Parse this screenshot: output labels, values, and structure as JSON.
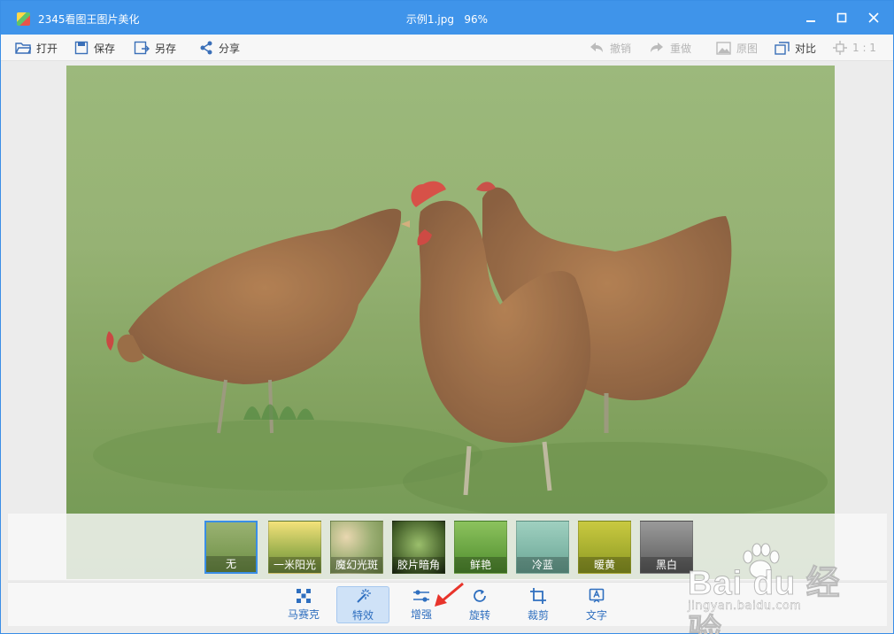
{
  "window": {
    "app_title": "2345看图王图片美化",
    "file_name": "示例1.jpg",
    "zoom": "96%"
  },
  "toolbar": {
    "open": "打开",
    "save": "保存",
    "save_as": "另存",
    "share": "分享",
    "undo": "撤销",
    "redo": "重做",
    "original": "原图",
    "compare": "对比",
    "ratio": "1 : 1"
  },
  "filters": [
    {
      "label": "无",
      "selected": true
    },
    {
      "label": "一米阳光",
      "selected": false
    },
    {
      "label": "魔幻光斑",
      "selected": false
    },
    {
      "label": "胶片暗角",
      "selected": false
    },
    {
      "label": "鲜艳",
      "selected": false
    },
    {
      "label": "冷蓝",
      "selected": false
    },
    {
      "label": "暖黄",
      "selected": false
    },
    {
      "label": "黑白",
      "selected": false
    }
  ],
  "bottom_tools": [
    {
      "label": "马赛克",
      "icon": "mosaic-icon",
      "active": false
    },
    {
      "label": "特效",
      "icon": "magic-wand-icon",
      "active": true
    },
    {
      "label": "增强",
      "icon": "sliders-icon",
      "active": false
    },
    {
      "label": "旋转",
      "icon": "rotate-icon",
      "active": false
    },
    {
      "label": "裁剪",
      "icon": "crop-icon",
      "active": false
    },
    {
      "label": "文字",
      "icon": "text-icon",
      "active": false
    }
  ],
  "watermark": {
    "brand": "Bai du 经验",
    "url": "jingyan.baidu.com"
  },
  "colors": {
    "titlebar": "#3f94ea",
    "accent": "#3a8ee6",
    "tool_text": "#2f6fbf",
    "arrow": "#e8342b"
  }
}
